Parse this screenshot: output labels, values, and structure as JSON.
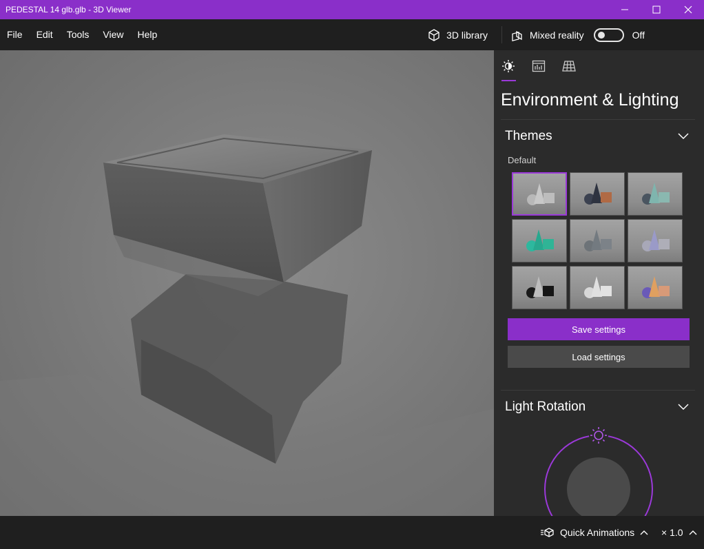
{
  "window": {
    "title": "PEDESTAL 14 glb.glb - 3D Viewer",
    "minimize_icon": "minimize-icon",
    "maximize_icon": "maximize-icon",
    "close_icon": "close-icon"
  },
  "menu": {
    "items": [
      "File",
      "Edit",
      "Tools",
      "View",
      "Help"
    ],
    "library_label": "3D library",
    "mixed_reality_label": "Mixed reality",
    "mixed_reality_state": "Off",
    "mixed_reality_on": false
  },
  "panel": {
    "tabs": [
      {
        "icon": "environment-lighting-icon",
        "active": true
      },
      {
        "icon": "stats-icon",
        "active": false
      },
      {
        "icon": "grid-icon",
        "active": false
      }
    ],
    "title": "Environment & Lighting",
    "themes": {
      "heading": "Themes",
      "group_label": "Default",
      "selected_index": 0
    },
    "save_label": "Save settings",
    "load_label": "Load settings",
    "light_rotation": {
      "heading": "Light Rotation"
    }
  },
  "status": {
    "quick_animations_label": "Quick Animations",
    "speed_label": "× 1.0"
  },
  "colors": {
    "accent": "#8a2fc9",
    "panel_bg": "#2b2b2b",
    "chrome_bg": "#1f1f1f"
  }
}
